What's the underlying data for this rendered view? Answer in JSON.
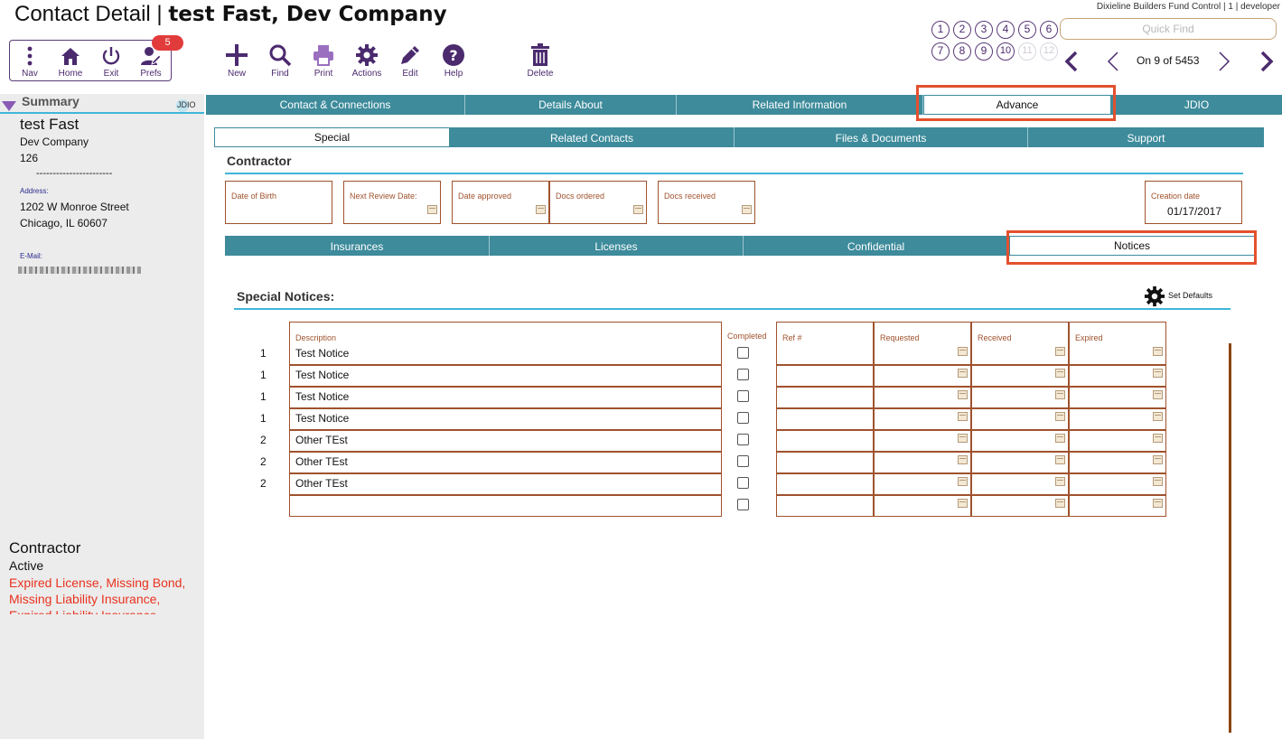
{
  "header": {
    "title_prefix": "Contact Detail | ",
    "title_record": "test Fast, Dev Company",
    "app_info": "Dixieline Builders Fund Control | 1 | developer"
  },
  "toolbar": {
    "nav": "Nav",
    "home": "Home",
    "exit": "Exit",
    "prefs": "Prefs",
    "prefs_badge": "5",
    "new": "New",
    "find": "Find",
    "print": "Print",
    "actions": "Actions",
    "edit": "Edit",
    "help": "Help",
    "delete": "Delete"
  },
  "circles": [
    "1",
    "2",
    "3",
    "4",
    "5",
    "6",
    "7",
    "8",
    "9",
    "10",
    "11",
    "12"
  ],
  "quick_find_placeholder": "Quick Find",
  "record_nav": "On 9 of 5453",
  "summary": {
    "label": "Summary",
    "jdio": "JDIO",
    "name": "test Fast",
    "company": "Dev Company",
    "number": "126",
    "separator": "-----------------------",
    "address_label": "Address:",
    "address_line1": "1202 W Monroe Street",
    "address_line2": "Chicago, IL  60607",
    "email_label": "E-Mail:",
    "type": "Contractor",
    "status": "Active",
    "warnings_1": "Expired License, Missing Bond,",
    "warnings_2": "Missing Liability Insurance,",
    "warnings_3": "Expired Liability Insurance"
  },
  "main_tabs": [
    "Contact & Connections",
    "Details About",
    "Related Information",
    "Advance",
    "JDIO"
  ],
  "sub_tabs": [
    "Special",
    "Related Contacts",
    "Files & Documents",
    "Support"
  ],
  "contractor": {
    "title": "Contractor",
    "date_of_birth": "Date of Birth",
    "next_review": "Next Review Date:",
    "date_approved": "Date approved",
    "docs_ordered": "Docs ordered",
    "docs_received": "Docs received",
    "creation_date_label": "Creation date",
    "creation_date_value": "01/17/2017"
  },
  "inner_tabs": [
    "Insurances",
    "Licenses",
    "Confidential",
    "Notices"
  ],
  "notices": {
    "title": "Special Notices:",
    "set_defaults": "Set Defaults",
    "col_description": "Description",
    "col_completed": "Completed",
    "col_ref": "Ref #",
    "col_requested": "Requested",
    "col_received": "Received",
    "col_expired": "Expired",
    "rows": [
      {
        "num": "1",
        "desc": "Test Notice"
      },
      {
        "num": "1",
        "desc": "Test Notice"
      },
      {
        "num": "1",
        "desc": "Test Notice"
      },
      {
        "num": "1",
        "desc": "Test Notice"
      },
      {
        "num": "2",
        "desc": "Other TEst"
      },
      {
        "num": "2",
        "desc": "Other TEst"
      },
      {
        "num": "2",
        "desc": "Other TEst"
      },
      {
        "num": "",
        "desc": ""
      }
    ]
  },
  "colors": {
    "accent_purple": "#4b2a6e",
    "tab_teal": "#3d8b9b",
    "field_border": "#a0522d",
    "warning_red": "#e8321e",
    "highlight_red": "#e4502e"
  }
}
